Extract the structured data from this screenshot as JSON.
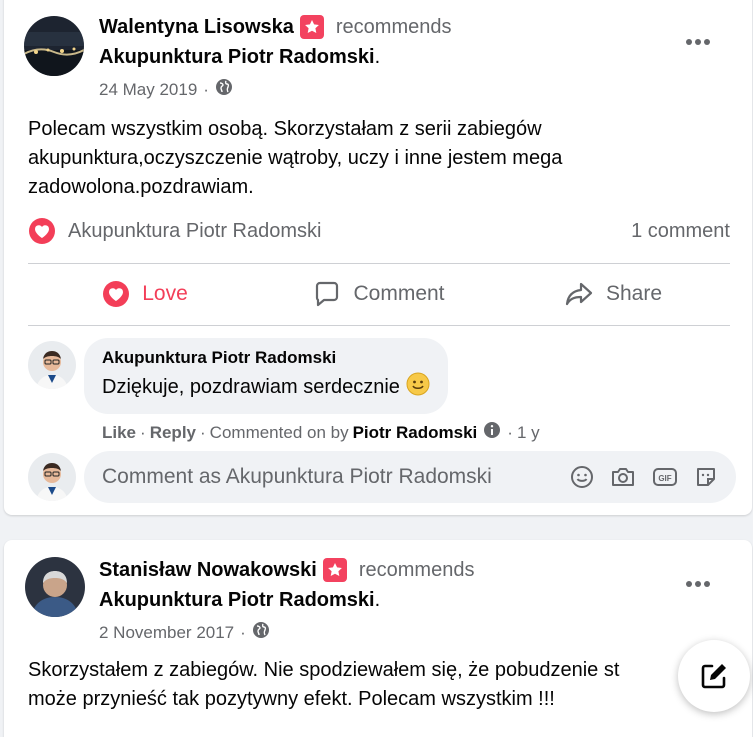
{
  "post1": {
    "author": "Walentyna Lisowska",
    "verb": "recommends",
    "page": "Akupunktura Piotr Radomski",
    "page_suffix": ".",
    "date": "24 May 2019",
    "date_sep": "·",
    "text": "Polecam wszystkim osobą. Skorzystałam z serii zabiegów akupunktura,oczyszczenie wątroby, uczy i inne jestem mega zadowolona.pozdrawiam.",
    "reactor": "Akupunktura Piotr Radomski",
    "comment_count": "1 comment",
    "actions": {
      "love": "Love",
      "comment": "Comment",
      "share": "Share"
    },
    "comment": {
      "author": "Akupunktura Piotr Radomski",
      "text": "Dziękuje, pozdrawiam serdecznie",
      "like": "Like",
      "reply": "Reply",
      "commented_on_by": "Commented on by",
      "commenter": "Piotr Radomski",
      "age": "1 y",
      "sep": "·"
    },
    "composer_placeholder": "Comment as Akupunktura Piotr Radomski"
  },
  "post2": {
    "author": "Stanisław Nowakowski",
    "verb": "recommends",
    "page": "Akupunktura Piotr Radomski",
    "page_suffix": ".",
    "date": "2 November 2017",
    "date_sep": "·",
    "text": "Skorzystałem z zabiegów. Nie spodziewałem się, że pobudzenie st... może przynieść tak pozytywny efekt. Polecam wszystkim !!!",
    "text_line1": "Skorzystałem z zabiegów. Nie spodziewałem się, że pobudzenie st",
    "text_line2": "może przynieść tak pozytywny efekt. Polecam wszystkim !!!"
  },
  "colors": {
    "love": "#f33e58",
    "muted": "#65676b",
    "badge": "#f3425f"
  },
  "icons": [
    "recommend-badge-icon",
    "globe-icon",
    "more-dots-icon",
    "heart-icon",
    "comment-icon",
    "share-icon",
    "smile-emoji-icon",
    "info-icon",
    "emoji-icon",
    "camera-icon",
    "gif-icon",
    "sticker-icon",
    "compose-icon"
  ]
}
